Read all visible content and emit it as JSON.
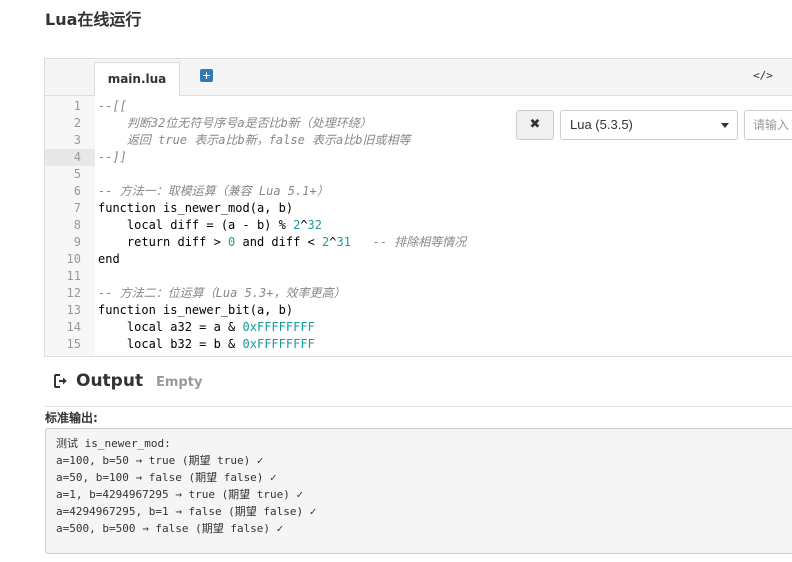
{
  "page": {
    "title": "Lua在线运行"
  },
  "editor": {
    "tab_label": "main.lua",
    "add_tab_icon": "plus-square-icon",
    "code_toggle_label": "</>",
    "active_line": 4,
    "lines": [
      {
        "n": "1",
        "segments": [
          {
            "t": "--[[",
            "c": "cm"
          }
        ]
      },
      {
        "n": "2",
        "segments": [
          {
            "t": "    判断32位无符号序号a是否比b新（处理环绕）",
            "c": "cm"
          }
        ]
      },
      {
        "n": "3",
        "segments": [
          {
            "t": "    返回 true 表示a比b新，false 表示a比b旧或相等",
            "c": "cm"
          }
        ]
      },
      {
        "n": "4",
        "segments": [
          {
            "t": "--]]",
            "c": "cm"
          }
        ]
      },
      {
        "n": "5",
        "segments": []
      },
      {
        "n": "6",
        "segments": [
          {
            "t": "-- 方法一：取模运算（兼容 Lua 5.1+）",
            "c": "cm"
          }
        ]
      },
      {
        "n": "7",
        "segments": [
          {
            "t": "function",
            "c": "kw"
          },
          {
            "t": " is_newer_mod(a, b)",
            "c": ""
          }
        ]
      },
      {
        "n": "8",
        "segments": [
          {
            "t": "    local",
            "c": "kw"
          },
          {
            "t": " diff = (a - b) % ",
            "c": ""
          },
          {
            "t": "2",
            "c": "num"
          },
          {
            "t": "^",
            "c": ""
          },
          {
            "t": "32",
            "c": "num"
          }
        ]
      },
      {
        "n": "9",
        "segments": [
          {
            "t": "    return",
            "c": "kw"
          },
          {
            "t": " diff > ",
            "c": ""
          },
          {
            "t": "0",
            "c": "num"
          },
          {
            "t": " ",
            "c": ""
          },
          {
            "t": "and",
            "c": "kw"
          },
          {
            "t": " diff < ",
            "c": ""
          },
          {
            "t": "2",
            "c": "num"
          },
          {
            "t": "^",
            "c": ""
          },
          {
            "t": "31",
            "c": "num"
          },
          {
            "t": "   -- 排除相等情况",
            "c": "cm"
          }
        ]
      },
      {
        "n": "10",
        "segments": [
          {
            "t": "end",
            "c": "kw"
          }
        ]
      },
      {
        "n": "11",
        "segments": []
      },
      {
        "n": "12",
        "segments": [
          {
            "t": "-- 方法二：位运算（Lua 5.3+，效率更高）",
            "c": "cm"
          }
        ]
      },
      {
        "n": "13",
        "segments": [
          {
            "t": "function",
            "c": "kw"
          },
          {
            "t": " is_newer_bit(a, b)",
            "c": ""
          }
        ]
      },
      {
        "n": "14",
        "segments": [
          {
            "t": "    local",
            "c": "kw"
          },
          {
            "t": " a32 = a & ",
            "c": ""
          },
          {
            "t": "0xFFFFFFFF",
            "c": "num"
          }
        ]
      },
      {
        "n": "15",
        "segments": [
          {
            "t": "    local",
            "c": "kw"
          },
          {
            "t": " b32 = b & ",
            "c": ""
          },
          {
            "t": "0xFFFFFFFF",
            "c": "num"
          }
        ]
      }
    ]
  },
  "controls": {
    "clear_label": "✖",
    "language_selected": "Lua (5.3.5)",
    "stdin_placeholder": "请输入"
  },
  "output": {
    "title": "Output",
    "status": "Empty",
    "stdout_label": "标准输出:",
    "lines": [
      "测试 is_newer_mod:",
      "a=100, b=50 → true (期望 true) ✓",
      "a=50, b=100 → false (期望 false) ✓",
      "a=1, b=4294967295 → true (期望 true) ✓",
      "a=4294967295, b=1 → false (期望 false) ✓",
      "a=500, b=500 → false (期望 false) ✓"
    ]
  },
  "colors": {
    "accent": "#337ab7",
    "comment": "#888888",
    "number": "#1a9a9a"
  }
}
